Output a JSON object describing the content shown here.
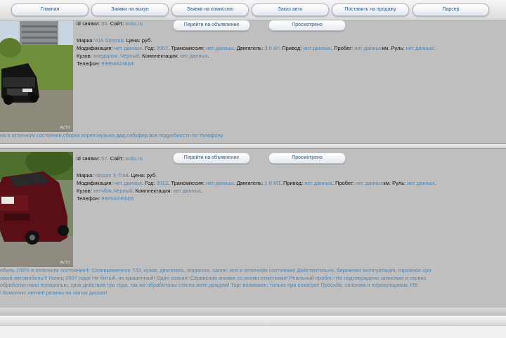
{
  "nav": {
    "home": "Главная",
    "buyout": "Заявки на выкуп",
    "commission": "Заявки на комиссию",
    "order_car": "Заказ авто",
    "sell": "Поставить на продажу",
    "parser": "Парсер"
  },
  "labels": {
    "request_id": "id заявки:",
    "site": "Сайт:",
    "brand": "Марка:",
    "price": "Цена:",
    "currency": "руб.",
    "modification": "Модификация:",
    "year": "Год:",
    "transmission": "Трансмиссия:",
    "engine": "Двигатель:",
    "drive": "Привод:",
    "mileage": "Пробег:",
    "km": "км.",
    "wheel": "Руль:",
    "body": "Кузов:",
    "equipment": "Комплектация:",
    "phone": "Телефон:",
    "go_to_ad": "Перейти на объявление",
    "viewed": "Просмотрено",
    "watermark": "AVITO"
  },
  "cars": [
    {
      "id": "56",
      "site": "avito.ru",
      "brand": "KIA Sorento",
      "modification": "нет данных",
      "year": "2007",
      "transmission": "3.0 AT",
      "drive": "нет данных",
      "mileage": "нет данных",
      "wheel": "нет данных",
      "body": "внедорож.,Чёрный",
      "equipment": "нет данных",
      "phone": "89854424664",
      "description": [
        "на в отличном состоянии,сборка корея.музыка двд,сабуфер.все подробности по телефону."
      ]
    },
    {
      "id": "57",
      "site": "avito.ru",
      "brand": "Nissan X-Trail",
      "modification": "нет данных",
      "year": "2013",
      "transmission": "нет данных",
      "engine": "1.6 MT",
      "drive": "нет данных",
      "mileage": "нет данных",
      "wheel": "нет данных",
      "body": "хетчбэк,Чёрный",
      "equipment": "нет данных",
      "phone": "89253235505",
      "description": [
        "обиль 100% в отличном состоянии!!! Своевременное Т/О, кузов, двигатель, подвеска, салон, все в отличном состоянии! Действительно, бережная эксплуатация, гаражное хра",
        "овый автомобиль!!! Конец 2007 года! Не битый, не крашенный! Один хозяин! Сервисная книжка со всеми отметками! Реальный пробег, что подтверждено записями в сервис",
        "обработан нано полиролью, срок действия три года, так же обработаны стекла анти дождем! Торг возможен, только при осмотре! Просьба, салонам и перекупщикам, НЕ",
        "! Комплект летней резины на литых дисках!"
      ]
    }
  ]
}
